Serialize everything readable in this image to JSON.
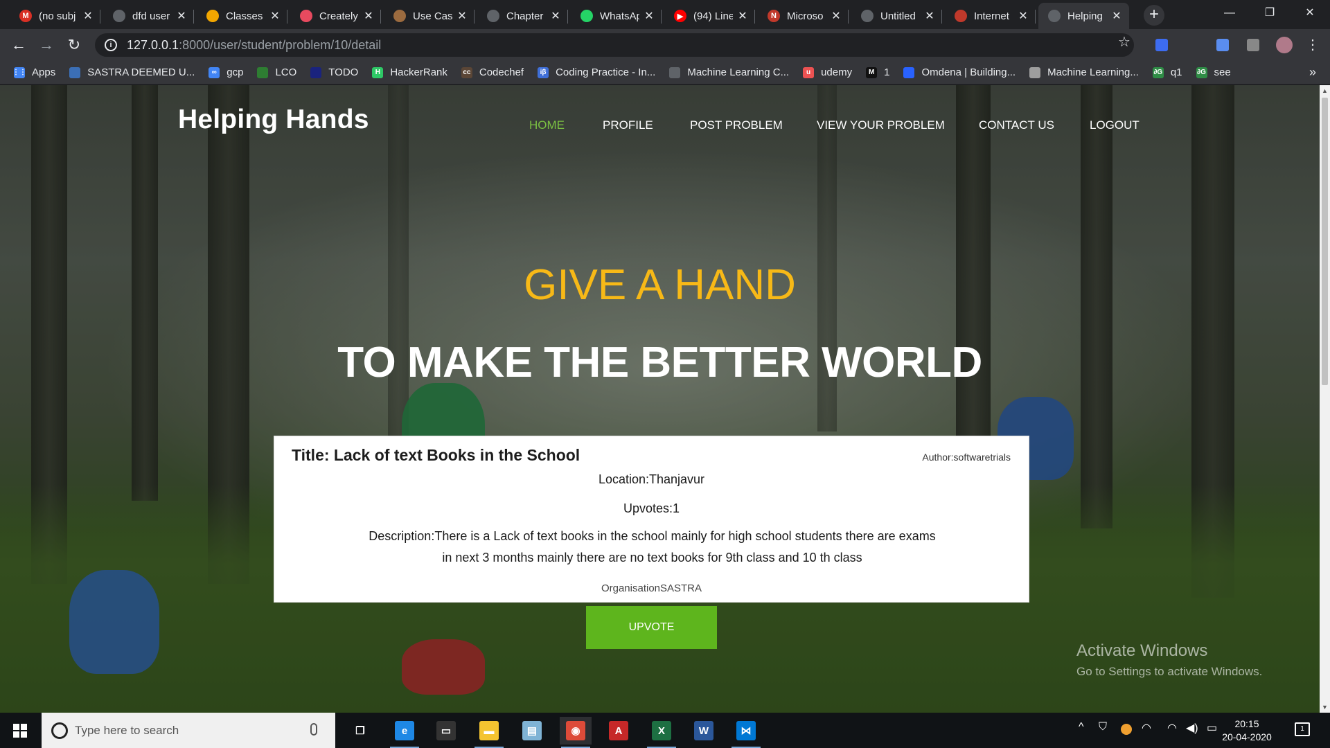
{
  "browser": {
    "tabs": [
      {
        "title": "(no subj",
        "icon": "gmail-icon",
        "color": "#d93025",
        "glyph": "M"
      },
      {
        "title": "dfd user",
        "icon": "globe-icon",
        "color": "#5f6368",
        "glyph": ""
      },
      {
        "title": "Classes",
        "icon": "classroom-icon",
        "color": "#f2a600",
        "glyph": ""
      },
      {
        "title": "Creately",
        "icon": "creately-icon",
        "color": "#e84a5f",
        "glyph": ""
      },
      {
        "title": "Use Case",
        "icon": "box-icon",
        "color": "#9c6b3f",
        "glyph": ""
      },
      {
        "title": "Chapter",
        "icon": "globe-icon",
        "color": "#5f6368",
        "glyph": ""
      },
      {
        "title": "WhatsAp",
        "icon": "whatsapp-icon",
        "color": "#25d366",
        "glyph": ""
      },
      {
        "title": "(94) Line",
        "icon": "youtube-icon",
        "color": "#ff0000",
        "glyph": "▶"
      },
      {
        "title": "Microso",
        "icon": "microsoft-icon",
        "color": "#c0392b",
        "glyph": "N"
      },
      {
        "title": "Untitled",
        "icon": "globe-icon",
        "color": "#5f6368",
        "glyph": ""
      },
      {
        "title": "Internet",
        "icon": "arc-icon",
        "color": "#c0392b",
        "glyph": ""
      },
      {
        "title": "Helping",
        "icon": "globe-icon",
        "color": "#5f6368",
        "glyph": "",
        "active": true
      }
    ],
    "close_glyph": "✕",
    "new_tab_glyph": "+",
    "window_controls": {
      "minimize": "—",
      "maximize": "❐",
      "close": "✕"
    },
    "nav": {
      "back": "←",
      "forward": "→",
      "reload": "↻",
      "star": "☆",
      "menu": "⋮"
    },
    "url": {
      "host": "127.0.0.1",
      "path": ":8000/user/student/problem/10/detail",
      "info_glyph": "i"
    },
    "bookmarks": [
      {
        "label": "Apps",
        "icon": "apps-grid-icon",
        "color": "#4285f4",
        "glyph": "⋮⋮"
      },
      {
        "label": "SASTRA DEEMED U...",
        "icon": "sastra-icon",
        "color": "#3b6fb6",
        "glyph": ""
      },
      {
        "label": "gcp",
        "icon": "gcp-icon",
        "color": "#4285f4",
        "glyph": "∞"
      },
      {
        "label": "LCO",
        "icon": "lco-icon",
        "color": "#2e7d32",
        "glyph": ""
      },
      {
        "label": "TODO",
        "icon": "todo-icon",
        "color": "#1a237e",
        "glyph": ""
      },
      {
        "label": "HackerRank",
        "icon": "hackerrank-icon",
        "color": "#2ec866",
        "glyph": "H"
      },
      {
        "label": "Codechef",
        "icon": "codechef-icon",
        "color": "#5b4636",
        "glyph": "cc"
      },
      {
        "label": "Coding Practice - In...",
        "icon": "ib-icon",
        "color": "#3f6fd8",
        "glyph": "iβ"
      },
      {
        "label": "Machine Learning C...",
        "icon": "globe-icon",
        "color": "#5f6368",
        "glyph": ""
      },
      {
        "label": "udemy",
        "icon": "udemy-icon",
        "color": "#ec5252",
        "glyph": "u"
      },
      {
        "label": "1",
        "icon": "medium-icon",
        "color": "#111111",
        "glyph": "M"
      },
      {
        "label": "Omdena | Building...",
        "icon": "omdena-icon",
        "color": "#2962ff",
        "glyph": ""
      },
      {
        "label": "Machine Learning...",
        "icon": "ml-icon",
        "color": "#9e9e9e",
        "glyph": ""
      },
      {
        "label": "q1",
        "icon": "gfg-icon",
        "color": "#2f8d46",
        "glyph": "∂G"
      },
      {
        "label": "see",
        "icon": "gfg-icon",
        "color": "#2f8d46",
        "glyph": "∂G"
      }
    ],
    "bookmarks_more": "»"
  },
  "site": {
    "brand": "Helping Hands",
    "menu": [
      {
        "label": "HOME",
        "active": true
      },
      {
        "label": "PROFILE"
      },
      {
        "label": "POST PROBLEM"
      },
      {
        "label": "VIEW YOUR PROBLEM"
      },
      {
        "label": "CONTACT US"
      },
      {
        "label": "LOGOUT"
      }
    ],
    "hero_line_1": "GIVE A HAND",
    "hero_line_2": "TO MAKE THE BETTER WORLD",
    "accent_color": "#f7b917",
    "active_menu_color": "#7bc142"
  },
  "problem": {
    "title": "Title: Lack of text Books in the School",
    "author": "Author:softwaretrials",
    "location": "Location:Thanjavur",
    "upvotes": "Upvotes:1",
    "description": "Description:There is a Lack of text books in the school mainly for high school students there are exams in next 3 months mainly there are no text books for 9th class and 10 th class",
    "organisation": "OrganisationSASTRA",
    "upvote_button": "UPVOTE",
    "button_color": "#5eb51d"
  },
  "windows_watermark": {
    "line1": "Activate Windows",
    "line2": "Go to Settings to activate Windows."
  },
  "taskbar": {
    "search_placeholder": "Type here to search",
    "apps": [
      {
        "name": "task-view-icon",
        "glyph": "❐",
        "color": "transparent"
      },
      {
        "name": "edge-icon",
        "glyph": "e",
        "color": "#1e88e5"
      },
      {
        "name": "terminal-icon",
        "glyph": "▭",
        "color": "#333333"
      },
      {
        "name": "file-explorer-icon",
        "glyph": "▬",
        "color": "#f4c430"
      },
      {
        "name": "notepad-icon",
        "glyph": "▤",
        "color": "#7fb3d5"
      },
      {
        "name": "chrome-icon",
        "glyph": "◉",
        "color": "#dd4b39"
      },
      {
        "name": "acrobat-icon",
        "glyph": "A",
        "color": "#c62828"
      },
      {
        "name": "excel-icon",
        "glyph": "X",
        "color": "#1d6f42"
      },
      {
        "name": "word-icon",
        "glyph": "W",
        "color": "#2b579a"
      },
      {
        "name": "vscode-icon",
        "glyph": "⋈",
        "color": "#0078d4"
      }
    ],
    "tray": {
      "chevron": "^",
      "shield": "⛉",
      "wifi": "◠",
      "volume": "◀)",
      "battery": "▭"
    },
    "time": "20:15",
    "date": "20-04-2020",
    "notification_count": "1"
  }
}
